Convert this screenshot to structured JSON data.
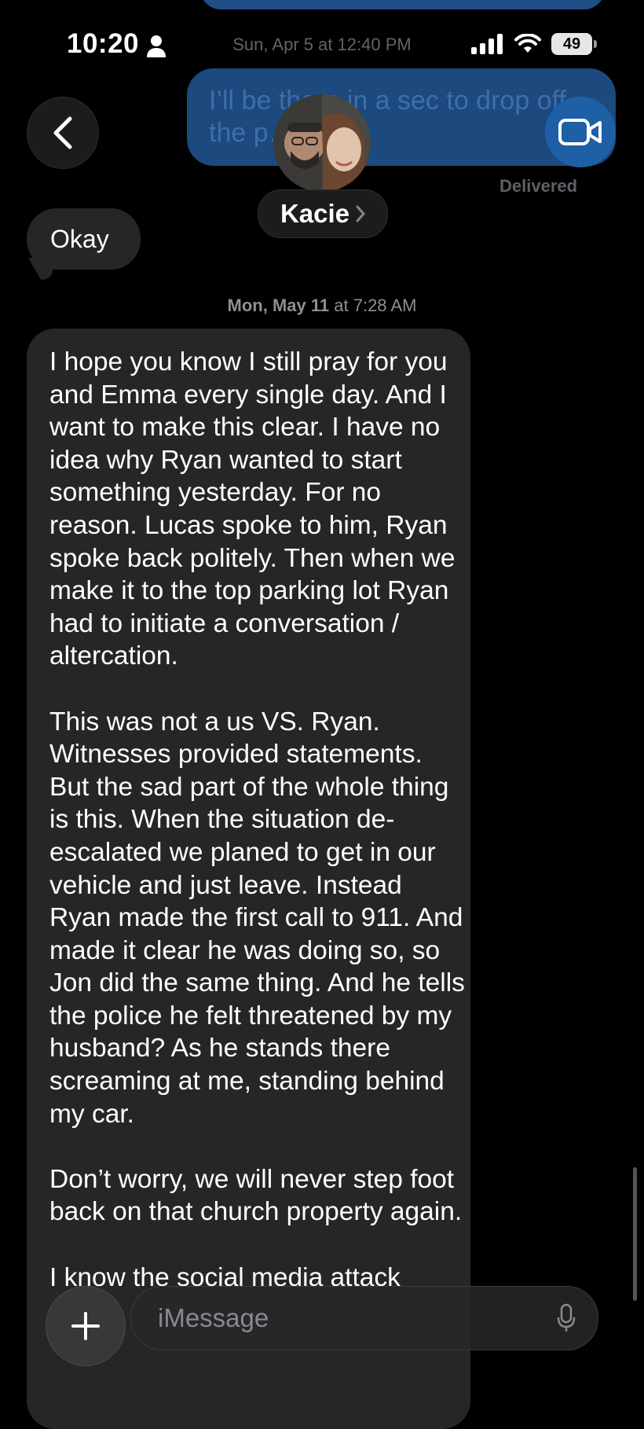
{
  "status_bar": {
    "time": "10:20",
    "battery": "49",
    "date_header": "Sun, Apr 5 at 12:40 PM"
  },
  "thread": {
    "contact_name": "Kacie",
    "sent_preview": "I’ll be there in a sec to drop off the p…",
    "delivered_label": "Delivered",
    "received_short": "Okay",
    "timestamp_day": "Mon, May 11",
    "timestamp_time": "at 7:28 AM",
    "message_paragraphs": [
      "I hope you know I still pray for you and Emma every single day. And I want to make this clear. I have no idea why Ryan wanted to start something yesterday. For no reason. Lucas spoke to him, Ryan spoke back politely. Then when we make it to the top parking lot Ryan had to initiate a conversation / altercation.",
      "This was not a us VS. Ryan. Witnesses provided statements. But the sad part of the whole thing is this. When the situation de-escalated we planed to get in our vehicle and just leave. Instead Ryan made the first call to 911. And made it clear he was doing so, so Jon did the same thing. And he tells the police he felt threatened by my husband? As he stands there screaming at me, standing behind my car.",
      "Don’t worry, we will never step foot back on that church property again.",
      "I know the social media attack"
    ]
  },
  "composer": {
    "placeholder": "iMessage"
  },
  "icons": {
    "back": "chevron-left-icon",
    "facetime": "video-camera-icon",
    "plus": "plus-icon",
    "mic": "microphone-icon",
    "person": "person-icon",
    "signal": "cellular-signal-icon",
    "wifi": "wifi-icon",
    "battery": "battery-icon"
  },
  "colors": {
    "background": "#000000",
    "received_bubble": "#262628",
    "sent_bubble": "#1e4d85",
    "accent": "#1f5fa6"
  }
}
